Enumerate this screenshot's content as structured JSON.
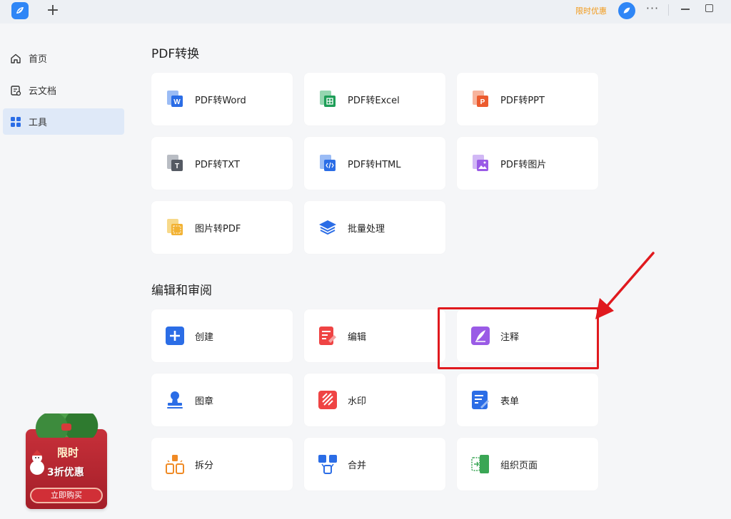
{
  "titlebar": {
    "app_icon": "app-logo-icon",
    "new_tab_label": "+",
    "promo_text": "限时优惠",
    "more_label": "···"
  },
  "sidebar": {
    "items": [
      {
        "label": "首页",
        "icon": "home-icon"
      },
      {
        "label": "云文档",
        "icon": "cloud-doc-icon"
      },
      {
        "label": "工具",
        "icon": "grid-icon",
        "active": true
      }
    ],
    "promo": {
      "title": "限时",
      "discount": "3折优惠",
      "button": "立即购买"
    }
  },
  "main": {
    "sections": [
      {
        "title": "PDF转换",
        "tools": [
          {
            "label": "PDF转Word",
            "icon": "word-icon",
            "color": "#2b6de6"
          },
          {
            "label": "PDF转Excel",
            "icon": "excel-icon",
            "color": "#1e9e58"
          },
          {
            "label": "PDF转PPT",
            "icon": "ppt-icon",
            "color": "#ec5b2e"
          },
          {
            "label": "PDF转TXT",
            "icon": "txt-icon",
            "color": "#555a63"
          },
          {
            "label": "PDF转HTML",
            "icon": "html-icon",
            "color": "#2b6de6"
          },
          {
            "label": "PDF转图片",
            "icon": "image-icon",
            "color": "#9a5be6"
          },
          {
            "label": "图片转PDF",
            "icon": "image-to-pdf-icon",
            "color": "#f2b233"
          },
          {
            "label": "批量处理",
            "icon": "layers-icon",
            "color": "#2b6de6"
          }
        ]
      },
      {
        "title": "编辑和审阅",
        "tools": [
          {
            "label": "创建",
            "icon": "plus-icon",
            "color": "#2b6de6"
          },
          {
            "label": "编辑",
            "icon": "edit-icon",
            "color": "#ef4444"
          },
          {
            "label": "注释",
            "icon": "annotate-icon",
            "color": "#9a5be6"
          },
          {
            "label": "图章",
            "icon": "stamp-icon",
            "color": "#2b6de6"
          },
          {
            "label": "水印",
            "icon": "watermark-icon",
            "color": "#ef4444"
          },
          {
            "label": "表单",
            "icon": "form-icon",
            "color": "#2b6de6"
          },
          {
            "label": "拆分",
            "icon": "split-icon",
            "color": "#f08a24"
          },
          {
            "label": "合并",
            "icon": "merge-icon",
            "color": "#2b6de6"
          },
          {
            "label": "组织页面",
            "icon": "organize-pages-icon",
            "color": "#3aa655"
          }
        ]
      }
    ]
  },
  "colors": {
    "accent": "#2f86f6",
    "highlight": "#e0191e",
    "promo_text": "#f29a1a"
  }
}
